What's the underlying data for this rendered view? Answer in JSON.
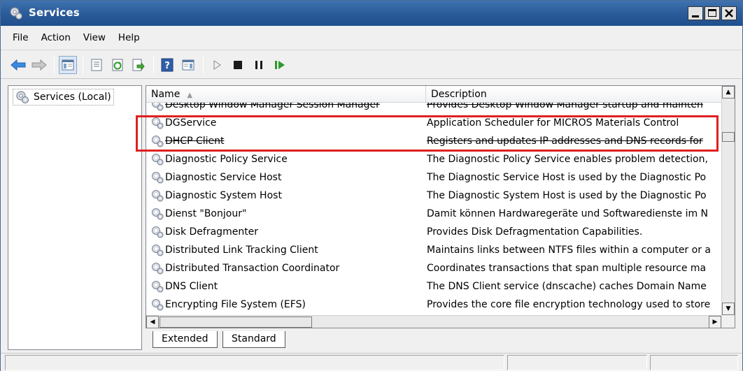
{
  "window": {
    "title": "Services",
    "controls": [
      "minimize",
      "maximize",
      "close"
    ]
  },
  "menu": {
    "items": [
      {
        "label": "File"
      },
      {
        "label": "Action"
      },
      {
        "label": "View"
      },
      {
        "label": "Help"
      }
    ]
  },
  "toolbar": {
    "buttons": [
      "back-icon",
      "forward-icon",
      "show-hide-console-tree-icon",
      "properties-icon",
      "refresh-icon",
      "export-list-icon",
      "help-icon",
      "show-action-pane-icon",
      "start-service-icon",
      "stop-service-icon",
      "pause-service-icon",
      "restart-service-icon"
    ]
  },
  "tree": {
    "root_label": "Services (Local)"
  },
  "list": {
    "columns": [
      {
        "label": "Name",
        "sorted": "ascending"
      },
      {
        "label": "Description"
      }
    ],
    "rows": [
      {
        "name": "Desktop Window Manager Session Manager",
        "description": "Provides Desktop Window Manager startup and mainten"
      },
      {
        "name": "DGService",
        "description": "Application Scheduler for MICROS Materials Control"
      },
      {
        "name": "DHCP Client",
        "description": "Registers and updates IP addresses and DNS records for"
      },
      {
        "name": "Diagnostic Policy Service",
        "description": "The Diagnostic Policy Service enables problem detection,"
      },
      {
        "name": "Diagnostic Service Host",
        "description": "The Diagnostic Service Host is used by the Diagnostic Po"
      },
      {
        "name": "Diagnostic System Host",
        "description": "The Diagnostic System Host is used by the Diagnostic Po"
      },
      {
        "name": "Dienst \"Bonjour\"",
        "description": "Damit können Hardwaregeräte und Softwaredienste im N"
      },
      {
        "name": "Disk Defragmenter",
        "description": "Provides Disk Defragmentation Capabilities."
      },
      {
        "name": "Distributed Link Tracking Client",
        "description": "Maintains links between NTFS files within a computer or a"
      },
      {
        "name": "Distributed Transaction Coordinator",
        "description": "Coordinates transactions that span multiple resource ma"
      },
      {
        "name": "DNS Client",
        "description": "The DNS Client service (dnscache) caches Domain Name"
      },
      {
        "name": "Encrypting File System (EFS)",
        "description": "Provides the core file encryption technology used to store"
      }
    ]
  },
  "tabs": [
    {
      "label": "Extended"
    },
    {
      "label": "Standard",
      "active": true
    }
  ],
  "colors": {
    "titlebar": "#2a5a98",
    "highlight": "#e02020"
  }
}
